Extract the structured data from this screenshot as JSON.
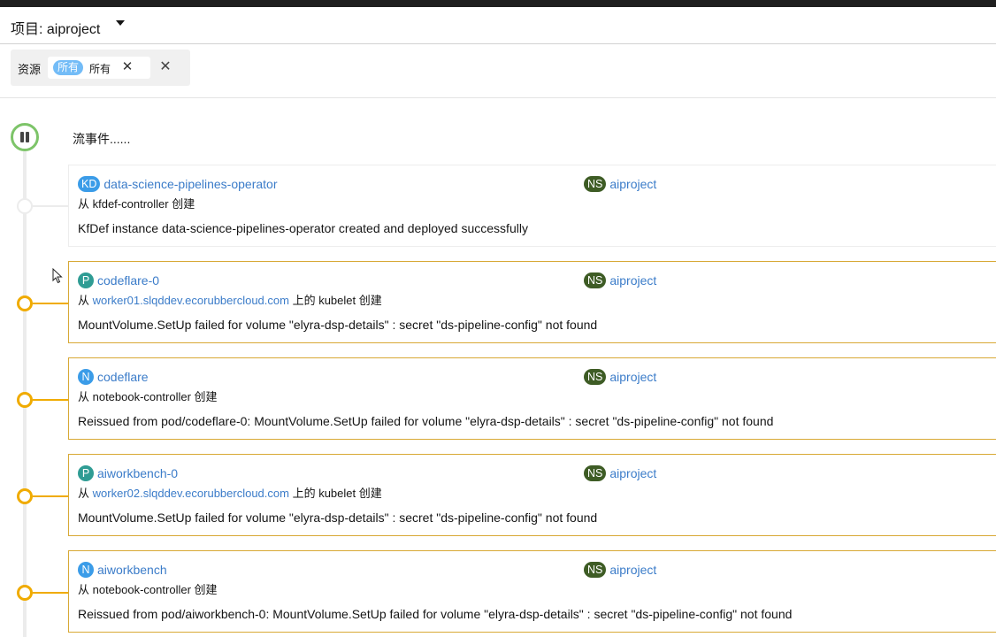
{
  "project": {
    "label": "项目: aiproject"
  },
  "filter": {
    "category": "资源",
    "chip_badge": "所有",
    "chip_text": "所有"
  },
  "stream": {
    "text": "流事件......"
  },
  "events": [
    {
      "kind_badge": "KD",
      "name": "data-science-pipelines-operator",
      "ns_badge": "NS",
      "namespace": "aiproject",
      "source_prefix": "从 kfdef-controller 创建",
      "source_link": "",
      "source_suffix": "",
      "message": "KfDef instance data-science-pipelines-operator created and deployed successfully",
      "severity": "normal"
    },
    {
      "kind_badge": "P",
      "name": "codeflare-0",
      "ns_badge": "NS",
      "namespace": "aiproject",
      "source_prefix": "从",
      "source_link": "worker01.slqddev.ecorubbercloud.com",
      "source_suffix": "上的 kubelet 创建",
      "message": "MountVolume.SetUp failed for volume \"elyra-dsp-details\" : secret \"ds-pipeline-config\" not found",
      "severity": "warning"
    },
    {
      "kind_badge": "N",
      "name": "codeflare",
      "ns_badge": "NS",
      "namespace": "aiproject",
      "source_prefix": "从 notebook-controller 创建",
      "source_link": "",
      "source_suffix": "",
      "message": "Reissued from pod/codeflare-0: MountVolume.SetUp failed for volume \"elyra-dsp-details\" : secret \"ds-pipeline-config\" not found",
      "severity": "warning"
    },
    {
      "kind_badge": "P",
      "name": "aiworkbench-0",
      "ns_badge": "NS",
      "namespace": "aiproject",
      "source_prefix": "从",
      "source_link": "worker02.slqddev.ecorubbercloud.com",
      "source_suffix": "上的 kubelet 创建",
      "message": "MountVolume.SetUp failed for volume \"elyra-dsp-details\" : secret \"ds-pipeline-config\" not found",
      "severity": "warning"
    },
    {
      "kind_badge": "N",
      "name": "aiworkbench",
      "ns_badge": "NS",
      "namespace": "aiproject",
      "source_prefix": "从 notebook-controller 创建",
      "source_link": "",
      "source_suffix": "",
      "message": "Reissued from pod/aiworkbench-0: MountVolume.SetUp failed for volume \"elyra-dsp-details\" : secret \"ds-pipeline-config\" not found",
      "severity": "warning"
    }
  ],
  "colors": {
    "warning": "#f0ab00",
    "link": "#3b7cc9",
    "ns_badge": "#3e5c25",
    "pod_badge": "#2f9c94",
    "kind_badge": "#3b9ce8",
    "play_ring": "#7dc469"
  },
  "icons": {
    "project_dropdown": "caret-down-icon",
    "chip_remove": "close-icon",
    "group_remove": "close-icon",
    "stream_toggle": "pause-icon"
  }
}
